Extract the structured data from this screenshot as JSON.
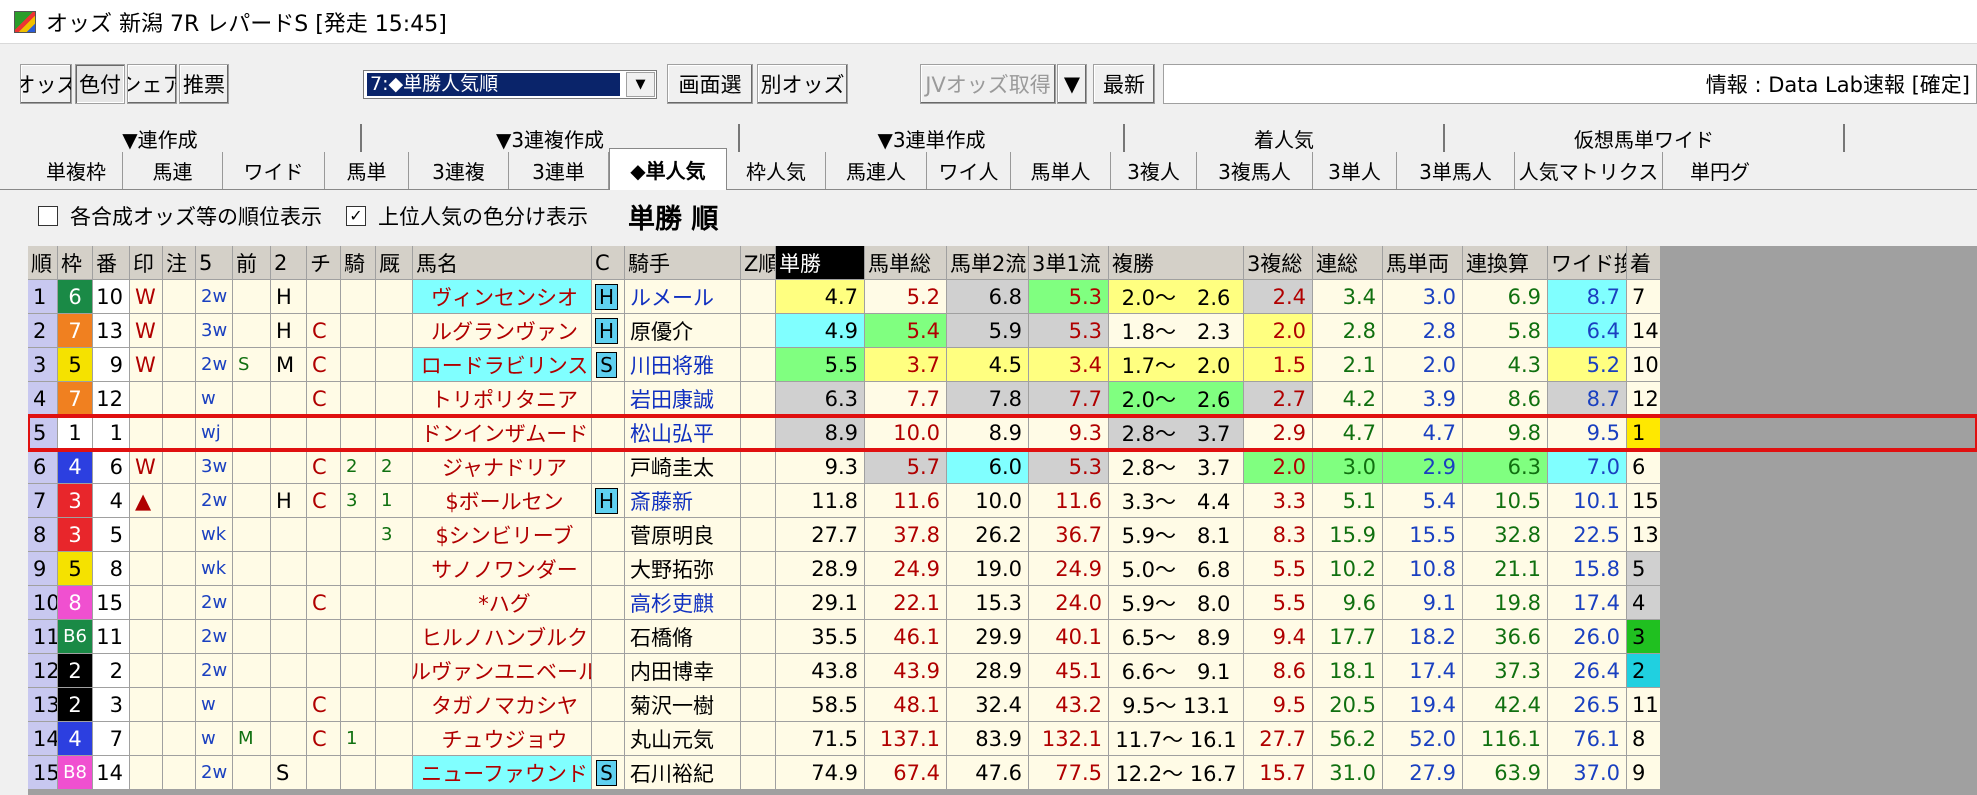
{
  "window": {
    "title": "オッズ 新潟 7R レパードS [発走 15:45]"
  },
  "toolbar": {
    "buttons": [
      {
        "label": "オッズ"
      },
      {
        "label": "色付"
      },
      {
        "label": "シェア"
      },
      {
        "label": "推票"
      }
    ],
    "sort_select": "7:◆単勝人気順",
    "screen_select": "画面選",
    "other_odds": "別オッズ",
    "jv_fetch": "JVオッズ取得",
    "latest": "最新",
    "info": "情報 : Data Lab速報 [確定]"
  },
  "tabs_row1": [
    "▼連作成",
    "▼3連複作成",
    "▼3連単作成",
    "着人気",
    "仮想馬単ワイド",
    ""
  ],
  "tabs_row2": [
    "単複枠",
    "馬連",
    "ワイド",
    "馬単",
    "3連複",
    "3連単",
    "◆単人気",
    "枠人気",
    "馬連人",
    "ワイ人",
    "馬単人",
    "3複人",
    "3複馬人",
    "3単人",
    "3単馬人",
    "人気マトリクス",
    "単円グ"
  ],
  "active_tab": 6,
  "options": {
    "rank_label": "各合成オッズ等の順位表示",
    "rank_checked": false,
    "color_label": "上位人気の色分け表示",
    "color_checked": true,
    "heading": "単勝 順"
  },
  "columns": [
    "順",
    "枠",
    "番",
    "印",
    "注",
    "5",
    "前",
    "2",
    "チ",
    "騎",
    "厩",
    "馬名",
    "C",
    "騎手",
    "Z順",
    "単勝",
    "馬単総",
    "馬単2流",
    "3単1流",
    "複勝",
    "3複総",
    "連総",
    "馬単両",
    "連換算",
    "ワイド換",
    "着"
  ],
  "colors": {
    "frame": {
      "1": "#ffffff",
      "2": "#000000",
      "3": "#e8262b",
      "4": "#2c3fe0",
      "5": "#f5e200",
      "6": "#1a8a46",
      "7": "#f08020",
      "8": "#f050d0"
    },
    "cell_yellow": "#ffff80",
    "cell_green": "#80ff80",
    "cell_cyan": "#80ffff",
    "cell_gray": "#d0d0d0",
    "cell_default": "#fffbe6",
    "selected_outline": "#e01010"
  },
  "rows": [
    {
      "rank": "1",
      "waku": "6",
      "num": "10",
      "mark": "W",
      "note": "",
      "p5": "2w",
      "mae": "",
      "p2": "H",
      "chi": "",
      "ki": "",
      "kyu": "",
      "name": "ヴィンセンシオ",
      "c": "H",
      "jockey": "ルメール",
      "z": "",
      "tan": "4.7",
      "uts": "5.2",
      "u2": "6.8",
      "s1": "5.3",
      "fuku": "2.0～　2.6",
      "f3": "2.4",
      "rs": "3.4",
      "ur": "3.0",
      "rk": "6.9",
      "wk": "8.7",
      "chaku": "7"
    },
    {
      "rank": "2",
      "waku": "7",
      "num": "13",
      "mark": "W",
      "note": "",
      "p5": "3w",
      "mae": "",
      "p2": "H",
      "chi": "C",
      "ki": "",
      "kyu": "",
      "name": "ルグランヴァン",
      "c": "H",
      "jockey": "原優介",
      "z": "",
      "tan": "4.9",
      "uts": "5.4",
      "u2": "5.9",
      "s1": "5.3",
      "fuku": "1.8～　2.3",
      "f3": "2.0",
      "rs": "2.8",
      "ur": "2.8",
      "rk": "5.8",
      "wk": "6.4",
      "chaku": "14"
    },
    {
      "rank": "3",
      "waku": "5",
      "num": "9",
      "mark": "W",
      "note": "",
      "p5": "2w",
      "mae": "S",
      "p2": "M",
      "chi": "C",
      "ki": "",
      "kyu": "",
      "name": "ロードラビリンス",
      "c": "S",
      "jockey": "川田将雅",
      "z": "",
      "tan": "5.5",
      "uts": "3.7",
      "u2": "4.5",
      "s1": "3.4",
      "fuku": "1.7～　2.0",
      "f3": "1.5",
      "rs": "2.1",
      "ur": "2.0",
      "rk": "4.3",
      "wk": "5.2",
      "chaku": "10"
    },
    {
      "rank": "4",
      "waku": "7",
      "num": "12",
      "mark": "",
      "note": "",
      "p5": "w",
      "mae": "",
      "p2": "",
      "chi": "C",
      "ki": "",
      "kyu": "",
      "name": "トリポリタニア",
      "c": "",
      "jockey": "岩田康誠",
      "z": "",
      "tan": "6.3",
      "uts": "7.7",
      "u2": "7.8",
      "s1": "7.7",
      "fuku": "2.0～　2.6",
      "f3": "2.7",
      "rs": "4.2",
      "ur": "3.9",
      "rk": "8.6",
      "wk": "8.7",
      "chaku": "12"
    },
    {
      "rank": "5",
      "waku": "1",
      "num": "1",
      "mark": "",
      "note": "",
      "p5": "wj",
      "mae": "",
      "p2": "",
      "chi": "",
      "ki": "",
      "kyu": "",
      "name": "ドンインザムード",
      "c": "",
      "jockey": "松山弘平",
      "z": "",
      "tan": "8.9",
      "uts": "10.0",
      "u2": "8.9",
      "s1": "9.3",
      "fuku": "2.8～　3.7",
      "f3": "2.9",
      "rs": "4.7",
      "ur": "4.7",
      "rk": "9.8",
      "wk": "9.5",
      "chaku": "1"
    },
    {
      "rank": "6",
      "waku": "4",
      "num": "6",
      "mark": "W",
      "note": "",
      "p5": "3w",
      "mae": "",
      "p2": "",
      "chi": "C",
      "ki": "2",
      "kyu": "2",
      "name": "ジャナドリア",
      "c": "",
      "jockey": "戸崎圭太",
      "z": "",
      "tan": "9.3",
      "uts": "5.7",
      "u2": "6.0",
      "s1": "5.3",
      "fuku": "2.8～　3.7",
      "f3": "2.0",
      "rs": "3.0",
      "ur": "2.9",
      "rk": "6.3",
      "wk": "7.0",
      "chaku": "6"
    },
    {
      "rank": "7",
      "waku": "3",
      "num": "4",
      "mark": "▲",
      "note": "",
      "p5": "2w",
      "mae": "",
      "p2": "H",
      "chi": "C",
      "ki": "3",
      "kyu": "1",
      "name": "$ボールセン",
      "c": "H",
      "jockey": "斎藤新",
      "z": "",
      "tan": "11.8",
      "uts": "11.6",
      "u2": "10.0",
      "s1": "11.6",
      "fuku": "3.3～　4.4",
      "f3": "3.3",
      "rs": "5.1",
      "ur": "5.4",
      "rk": "10.5",
      "wk": "10.1",
      "chaku": "15"
    },
    {
      "rank": "8",
      "waku": "3",
      "num": "5",
      "mark": "",
      "note": "",
      "p5": "wk",
      "mae": "",
      "p2": "",
      "chi": "",
      "ki": "",
      "kyu": "3",
      "name": "$シンビリーブ",
      "c": "",
      "jockey": "菅原明良",
      "z": "",
      "tan": "27.7",
      "uts": "37.8",
      "u2": "26.2",
      "s1": "36.7",
      "fuku": "5.9～　8.1",
      "f3": "8.3",
      "rs": "15.9",
      "ur": "15.5",
      "rk": "32.8",
      "wk": "22.5",
      "chaku": "13"
    },
    {
      "rank": "9",
      "waku": "5",
      "num": "8",
      "mark": "",
      "note": "",
      "p5": "wk",
      "mae": "",
      "p2": "",
      "chi": "",
      "ki": "",
      "kyu": "",
      "name": "サノノワンダー",
      "c": "",
      "jockey": "大野拓弥",
      "z": "",
      "tan": "28.9",
      "uts": "24.9",
      "u2": "19.0",
      "s1": "24.9",
      "fuku": "5.0～　6.8",
      "f3": "5.5",
      "rs": "10.2",
      "ur": "10.8",
      "rk": "21.1",
      "wk": "15.8",
      "chaku": "5"
    },
    {
      "rank": "10",
      "waku": "8",
      "num": "15",
      "mark": "",
      "note": "",
      "p5": "2w",
      "mae": "",
      "p2": "",
      "chi": "C",
      "ki": "",
      "kyu": "",
      "name": "*ハグ",
      "c": "",
      "jockey": "高杉吏麒",
      "z": "",
      "tan": "29.1",
      "uts": "22.1",
      "u2": "15.3",
      "s1": "24.0",
      "fuku": "5.9～　8.0",
      "f3": "5.5",
      "rs": "9.6",
      "ur": "9.1",
      "rk": "19.8",
      "wk": "17.4",
      "chaku": "4"
    },
    {
      "rank": "11",
      "waku": "B6",
      "num": "11",
      "mark": "",
      "note": "",
      "p5": "2w",
      "mae": "",
      "p2": "",
      "chi": "",
      "ki": "",
      "kyu": "",
      "name": "ヒルノハンブルク",
      "c": "",
      "jockey": "石橋脩",
      "z": "",
      "tan": "35.5",
      "uts": "46.1",
      "u2": "29.9",
      "s1": "40.1",
      "fuku": "6.5～　8.9",
      "f3": "9.4",
      "rs": "17.7",
      "ur": "18.2",
      "rk": "36.6",
      "wk": "26.0",
      "chaku": "3"
    },
    {
      "rank": "12",
      "waku": "2",
      "num": "2",
      "mark": "",
      "note": "",
      "p5": "2w",
      "mae": "",
      "p2": "",
      "chi": "",
      "ki": "",
      "kyu": "",
      "name": "ルヴァンユニベール",
      "c": "",
      "jockey": "内田博幸",
      "z": "",
      "tan": "43.8",
      "uts": "43.9",
      "u2": "28.9",
      "s1": "45.1",
      "fuku": "6.6～　9.1",
      "f3": "8.6",
      "rs": "18.1",
      "ur": "17.4",
      "rk": "37.3",
      "wk": "26.4",
      "chaku": "2"
    },
    {
      "rank": "13",
      "waku": "2",
      "num": "3",
      "mark": "",
      "note": "",
      "p5": "w",
      "mae": "",
      "p2": "",
      "chi": "C",
      "ki": "",
      "kyu": "",
      "name": "タガノマカシヤ",
      "c": "",
      "jockey": "菊沢一樹",
      "z": "",
      "tan": "58.5",
      "uts": "48.1",
      "u2": "32.4",
      "s1": "43.2",
      "fuku": "9.5～ 13.1",
      "f3": "9.5",
      "rs": "20.5",
      "ur": "19.4",
      "rk": "42.4",
      "wk": "26.5",
      "chaku": "11"
    },
    {
      "rank": "14",
      "waku": "4",
      "num": "7",
      "mark": "",
      "note": "",
      "p5": "w",
      "mae": "M",
      "p2": "",
      "chi": "C",
      "ki": "1",
      "kyu": "",
      "name": "チュウジョウ",
      "c": "",
      "jockey": "丸山元気",
      "z": "",
      "tan": "71.5",
      "uts": "137.1",
      "u2": "83.9",
      "s1": "132.1",
      "fuku": "11.7～ 16.1",
      "f3": "27.7",
      "rs": "56.2",
      "ur": "52.0",
      "rk": "116.1",
      "wk": "76.1",
      "chaku": "8"
    },
    {
      "rank": "15",
      "waku": "B8",
      "num": "14",
      "mark": "",
      "note": "",
      "p5": "2w",
      "mae": "",
      "p2": "S",
      "chi": "",
      "ki": "",
      "kyu": "",
      "name": "ニューファウンド",
      "c": "S",
      "jockey": "石川裕紀",
      "z": "",
      "tan": "74.9",
      "uts": "67.4",
      "u2": "47.6",
      "s1": "77.5",
      "fuku": "12.2～ 16.7",
      "f3": "15.7",
      "rs": "31.0",
      "ur": "27.9",
      "rk": "63.9",
      "wk": "37.0",
      "chaku": "9"
    }
  ]
}
